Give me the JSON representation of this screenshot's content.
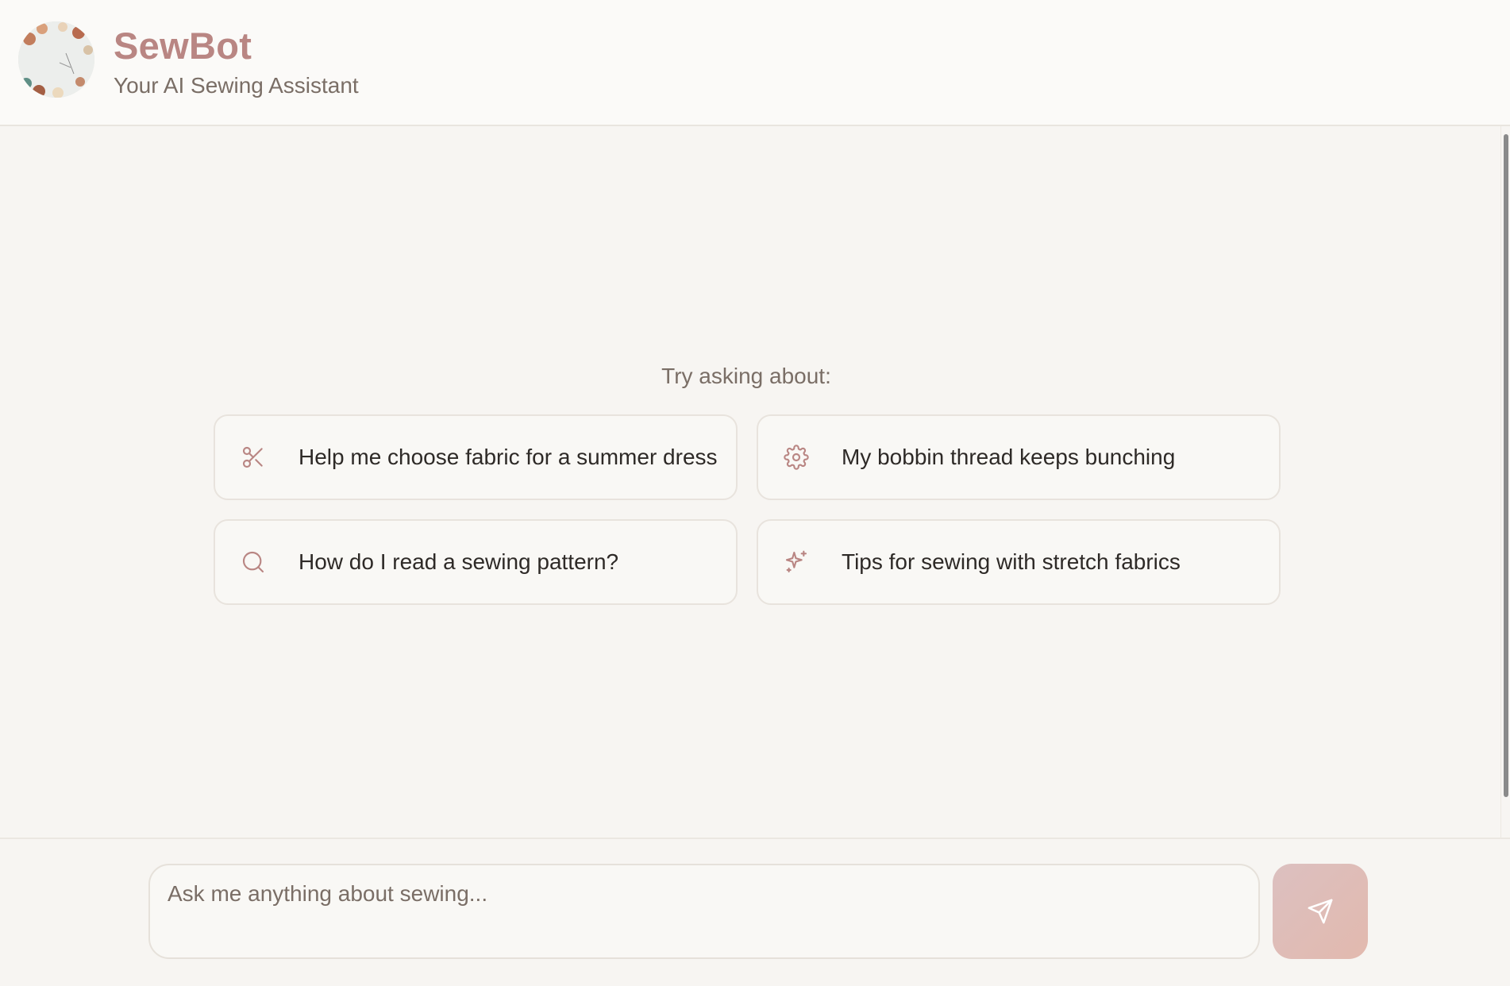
{
  "header": {
    "title": "SewBot",
    "subtitle": "Your AI Sewing Assistant",
    "avatar_icon": "sewing-supplies-avatar"
  },
  "main": {
    "prompt_label": "Try asking about:",
    "suggestions": [
      {
        "label": "Help me choose fabric for a summer dress",
        "icon": "scissors-icon"
      },
      {
        "label": "My bobbin thread keeps bunching",
        "icon": "gear-icon"
      },
      {
        "label": "How do I read a sewing pattern?",
        "icon": "search-icon"
      },
      {
        "label": "Tips for sewing with stretch fabrics",
        "icon": "sparkle-icon"
      }
    ]
  },
  "composer": {
    "placeholder": "Ask me anything about sewing...",
    "value": "",
    "send_icon": "send-icon"
  },
  "colors": {
    "accent": "#b98683",
    "text_primary": "#2e2a27",
    "text_muted": "#7a6e66",
    "background": "#f7f5f2"
  }
}
